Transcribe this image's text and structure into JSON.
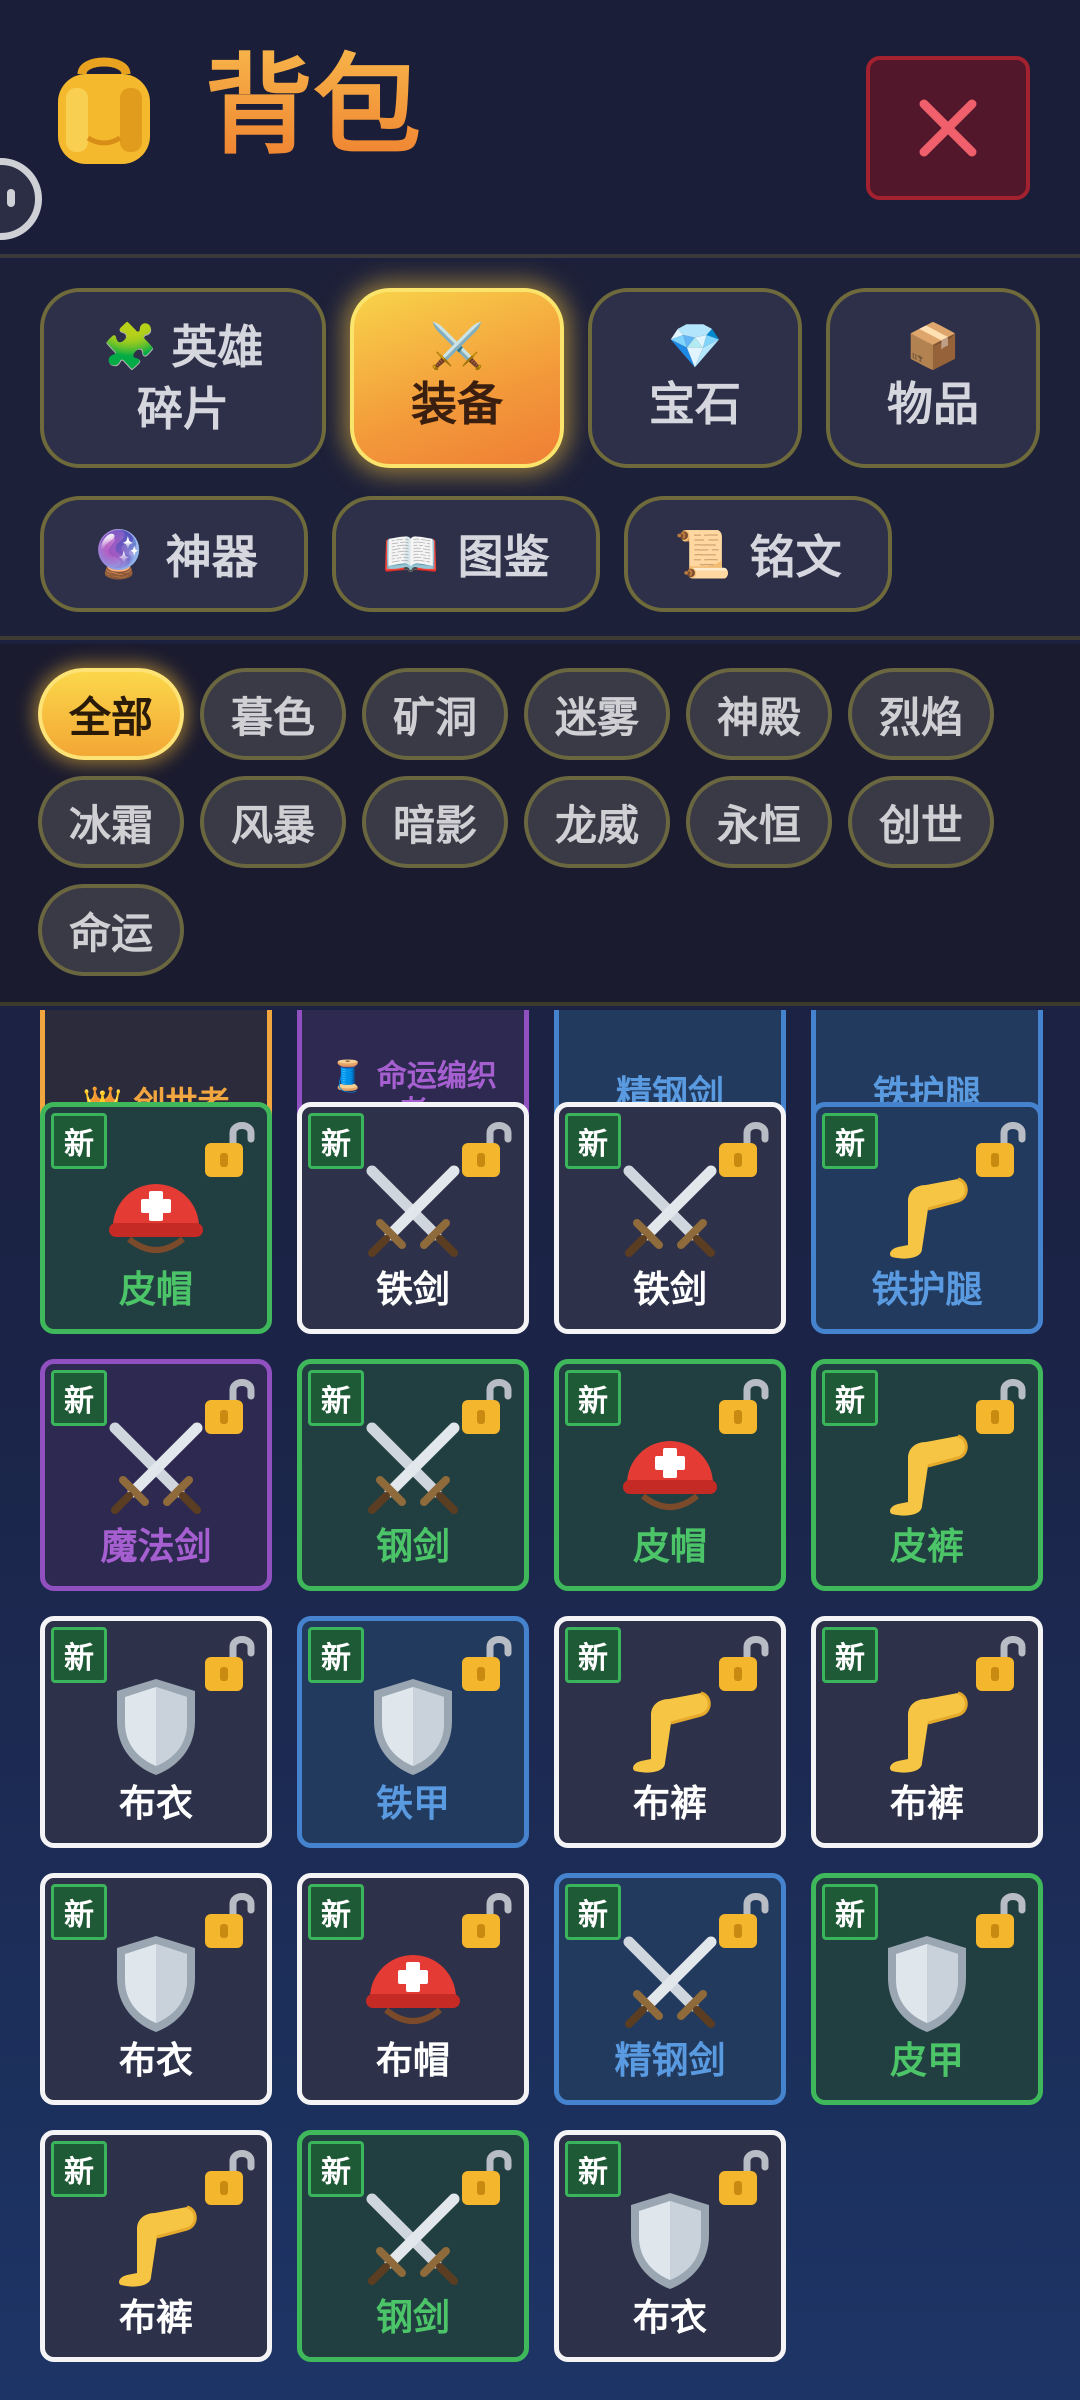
{
  "header": {
    "title": "背包",
    "icon": "backpack-icon",
    "close_icon": "close-icon"
  },
  "categories": [
    {
      "icon": "🧩",
      "line1": "英雄",
      "line2": "碎片"
    },
    {
      "icon": "⚔️",
      "line1": "装备",
      "active": true
    },
    {
      "icon": "💎",
      "line1": "宝石"
    },
    {
      "icon": "📦",
      "line1": "物品"
    }
  ],
  "categories_row2": [
    {
      "icon": "🔮",
      "label": "神器"
    },
    {
      "icon": "📖",
      "label": "图鉴"
    },
    {
      "icon": "📜",
      "label": "铭文"
    }
  ],
  "filters": [
    "全部",
    "暮色",
    "矿洞",
    "迷雾",
    "神殿",
    "烈焰",
    "冰霜",
    "风暴",
    "暗影",
    "龙威",
    "永恒",
    "创世",
    "命运"
  ],
  "active_filter": "全部",
  "partial_row": [
    {
      "label": "创世者",
      "icon": "👑"
    },
    {
      "label": "命运编织者",
      "icon": "🧵"
    },
    {
      "label": "精钢剑"
    },
    {
      "label": "铁护腿"
    }
  ],
  "new_badge": "新",
  "items": [
    {
      "name": "皮帽",
      "type": "helmet",
      "rarity": "green"
    },
    {
      "name": "铁剑",
      "type": "swords",
      "rarity": "white"
    },
    {
      "name": "铁剑",
      "type": "swords",
      "rarity": "white"
    },
    {
      "name": "铁护腿",
      "type": "leg",
      "rarity": "blue"
    },
    {
      "name": "魔法剑",
      "type": "swords",
      "rarity": "purple"
    },
    {
      "name": "钢剑",
      "type": "swords",
      "rarity": "green"
    },
    {
      "name": "皮帽",
      "type": "helmet",
      "rarity": "green"
    },
    {
      "name": "皮裤",
      "type": "leg",
      "rarity": "green"
    },
    {
      "name": "布衣",
      "type": "shield",
      "rarity": "white"
    },
    {
      "name": "铁甲",
      "type": "shield",
      "rarity": "blue"
    },
    {
      "name": "布裤",
      "type": "leg",
      "rarity": "white"
    },
    {
      "name": "布裤",
      "type": "leg",
      "rarity": "white"
    },
    {
      "name": "布衣",
      "type": "shield",
      "rarity": "white"
    },
    {
      "name": "布帽",
      "type": "helmet",
      "rarity": "white"
    },
    {
      "name": "精钢剑",
      "type": "swords",
      "rarity": "blue"
    },
    {
      "name": "皮甲",
      "type": "shield",
      "rarity": "green"
    },
    {
      "name": "布裤",
      "type": "leg",
      "rarity": "white"
    },
    {
      "name": "钢剑",
      "type": "swords",
      "rarity": "green"
    },
    {
      "name": "布衣",
      "type": "shield",
      "rarity": "white"
    }
  ]
}
